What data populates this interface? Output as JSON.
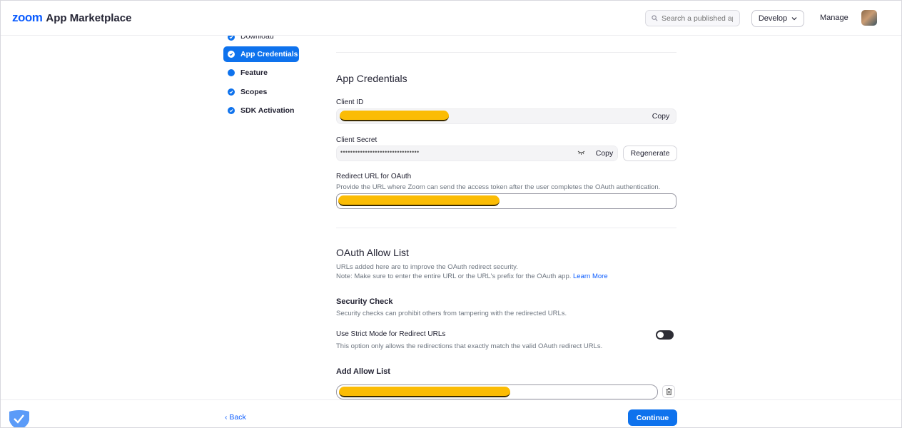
{
  "header": {
    "logo_zoom": "zoom",
    "logo_text": "App Marketplace",
    "search_placeholder": "Search a published app",
    "develop_label": "Develop",
    "manage_label": "Manage"
  },
  "sidebar": {
    "items": [
      {
        "label": "Download",
        "state": "done"
      },
      {
        "label": "App Credentials",
        "state": "active"
      },
      {
        "label": "Feature",
        "state": "pending"
      },
      {
        "label": "Scopes",
        "state": "done"
      },
      {
        "label": "SDK Activation",
        "state": "done"
      }
    ]
  },
  "credentials": {
    "title": "App Credentials",
    "client_id_label": "Client ID",
    "copy_label": "Copy",
    "client_secret_label": "Client Secret",
    "client_secret_value": "••••••••••••••••••••••••••••••••",
    "regenerate_label": "Regenerate",
    "redirect_label": "Redirect URL for OAuth",
    "redirect_help": "Provide the URL where Zoom can send the access token after the user completes the OAuth authentication."
  },
  "allow_list": {
    "title": "OAuth Allow List",
    "desc_line1": "URLs added here are to improve the OAuth redirect security.",
    "desc_line2": "Note: Make sure to enter the entire URL or the URL's prefix for the OAuth app.",
    "learn_more": "Learn More",
    "security_title": "Security Check",
    "security_desc": "Security checks can prohibit others from tampering with the redirected URLs.",
    "strict_label": "Use Strict Mode for Redirect URLs",
    "strict_desc": "This option only allows the redirections that exactly match the valid OAuth redirect URLs.",
    "strict_enabled": false,
    "add_title": "Add Allow List"
  },
  "footer": {
    "back_label": "Back",
    "continue_label": "Continue"
  },
  "colors": {
    "brand": "#0b5cff",
    "primary_button": "#0e72ed",
    "redaction": "#fbbc05"
  }
}
